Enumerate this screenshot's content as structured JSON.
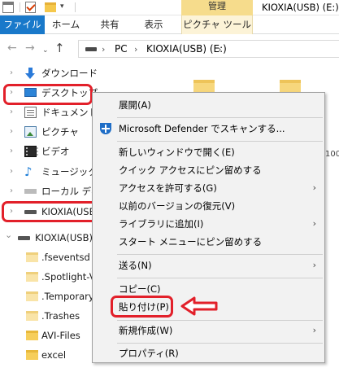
{
  "titlebar": {
    "manage_tab": "管理",
    "window_title": "KIOXIA(USB) (E:)",
    "qa_dropdown": "▾"
  },
  "ribbon": {
    "tabs": [
      "ファイル",
      "ホーム",
      "共有",
      "表示",
      "ピクチャ ツール"
    ]
  },
  "address": {
    "back": "←",
    "forward": "→",
    "recent": "⌄",
    "up": "↑",
    "crumb_sep": "›",
    "pc": "PC",
    "drive": "KIOXIA(USB) (E:)"
  },
  "navpane": {
    "items": [
      {
        "label": "ダウンロード",
        "icon": "download-icon"
      },
      {
        "label": "デスクトップ",
        "icon": "desktop-icon"
      },
      {
        "label": "ドキュメント",
        "icon": "documents-icon"
      },
      {
        "label": "ピクチャ",
        "icon": "pictures-icon"
      },
      {
        "label": "ビデオ",
        "icon": "videos-icon"
      },
      {
        "label": "ミュージック",
        "icon": "music-icon"
      },
      {
        "label": "ローカル ディス",
        "icon": "local-disk-icon"
      },
      {
        "label": "KIOXIA(USB",
        "icon": "usb-drive-icon"
      },
      {
        "label": "KIOXIA(USB) (",
        "icon": "usb-drive-icon"
      },
      {
        "label": ".fseventsd",
        "icon": "folder-icon"
      },
      {
        "label": ".Spotlight-V",
        "icon": "folder-icon"
      },
      {
        "label": ".Temporary",
        "icon": "folder-icon"
      },
      {
        "label": ".Trashes",
        "icon": "folder-icon"
      },
      {
        "label": "AVI-Files",
        "icon": "folder-icon"
      },
      {
        "label": "excel",
        "icon": "folder-icon"
      }
    ],
    "chevron_right": "›",
    "chevron_down": "⌄"
  },
  "content": {
    "partial_label": "100"
  },
  "context_menu": {
    "items": [
      {
        "label": "展開(A)"
      },
      {
        "label": "Microsoft Defender でスキャンする..."
      },
      {
        "label": "新しいウィンドウで開く(E)"
      },
      {
        "label": "クイック アクセスにピン留めする"
      },
      {
        "label": "アクセスを許可する(G)",
        "submenu": true
      },
      {
        "label": "以前のバージョンの復元(V)"
      },
      {
        "label": "ライブラリに追加(I)",
        "submenu": true
      },
      {
        "label": "スタート メニューにピン留めする"
      },
      {
        "label": "送る(N)",
        "submenu": true
      },
      {
        "label": "コピー(C)"
      },
      {
        "label": "貼り付け(P)"
      },
      {
        "label": "新規作成(W)",
        "submenu": true
      },
      {
        "label": "プロパティ(R)"
      }
    ],
    "submenu_arrow": "›"
  },
  "colors": {
    "file_tab": "#1979ca",
    "highlight": "#e2202a",
    "manage_tab": "#f6dc8c"
  }
}
